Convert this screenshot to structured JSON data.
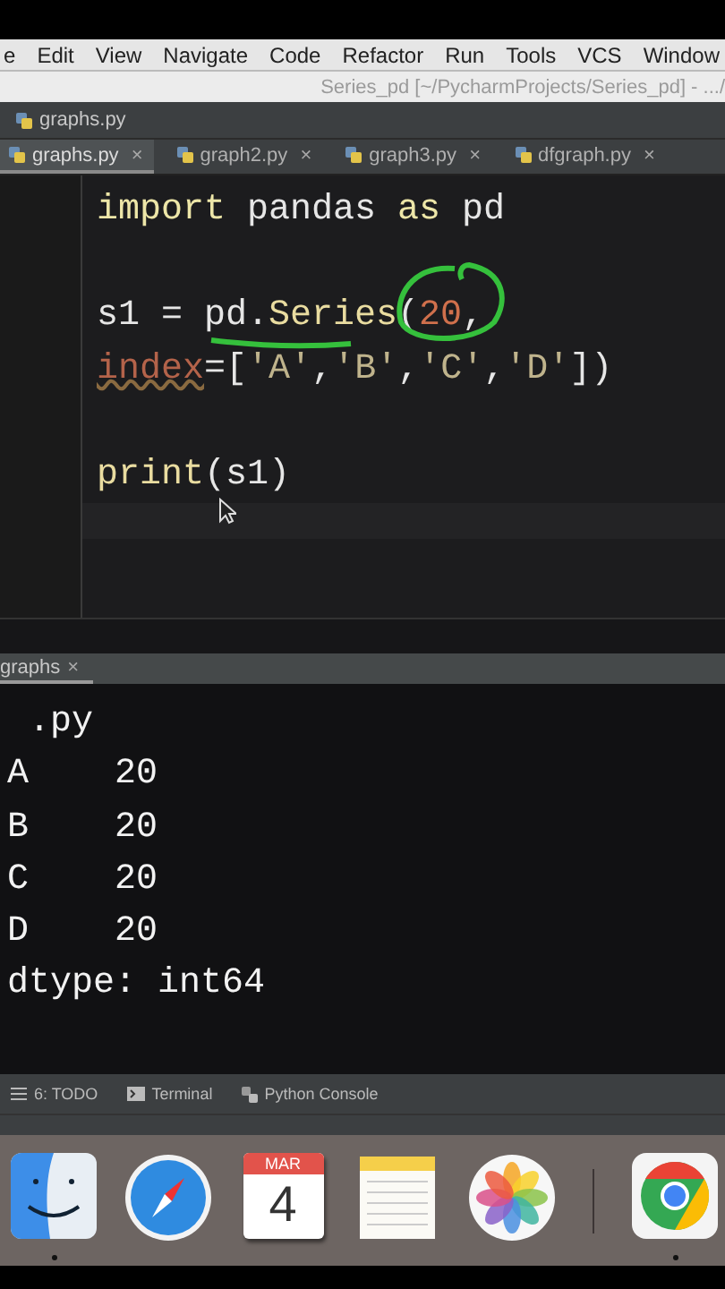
{
  "menu_bar": [
    "e",
    "Edit",
    "View",
    "Navigate",
    "Code",
    "Refactor",
    "Run",
    "Tools",
    "VCS",
    "Window"
  ],
  "title_bar": {
    "title": "Series_pd [~/PycharmProjects/Series_pd] - .../"
  },
  "breadcrumb": {
    "label": "graphs.py"
  },
  "tabs": [
    {
      "label": "graphs.py",
      "selected": true,
      "close": "×"
    },
    {
      "label": "graph2.py",
      "selected": false,
      "close": "×"
    },
    {
      "label": "graph3.py",
      "selected": false,
      "close": "×"
    },
    {
      "label": "dfgraph.py",
      "selected": false,
      "close": "×"
    }
  ],
  "editor": {
    "lines": [
      {
        "kind": "code",
        "tokens": [
          {
            "kind": "keyword",
            "text": "import"
          },
          {
            "kind": "plain",
            "text": " pandas "
          },
          {
            "kind": "keyword",
            "text": "as"
          },
          {
            "kind": "plain",
            "text": " pd"
          }
        ]
      },
      {
        "kind": "blank"
      },
      {
        "kind": "code",
        "tokens": [
          {
            "kind": "plain",
            "text": "s1 = pd."
          },
          {
            "kind": "function",
            "text": "Series"
          },
          {
            "kind": "plain",
            "text": "("
          },
          {
            "kind": "number",
            "text": "20"
          },
          {
            "kind": "plain",
            "text": ","
          }
        ]
      },
      {
        "kind": "code",
        "tokens": [
          {
            "kind": "param",
            "text": "index"
          },
          {
            "kind": "plain",
            "text": "=["
          },
          {
            "kind": "string",
            "text": "'A'"
          },
          {
            "kind": "plain",
            "text": ","
          },
          {
            "kind": "string",
            "text": "'B'"
          },
          {
            "kind": "plain",
            "text": ","
          },
          {
            "kind": "string",
            "text": "'C'"
          },
          {
            "kind": "plain",
            "text": ","
          },
          {
            "kind": "string",
            "text": "'D'"
          },
          {
            "kind": "plain",
            "text": "])"
          }
        ]
      },
      {
        "kind": "blank"
      },
      {
        "kind": "code",
        "tokens": [
          {
            "kind": "function",
            "text": "print"
          },
          {
            "kind": "plain",
            "text": "(s1)"
          }
        ]
      }
    ]
  },
  "run_panel": {
    "tab": {
      "label": "graphs",
      "close": "×"
    },
    "output": [
      " .py",
      "A    20",
      "B    20",
      "C    20",
      "D    20",
      "dtype: int64"
    ]
  },
  "tool_bar": [
    {
      "kind": "todo",
      "label": "6: TODO"
    },
    {
      "kind": "terminal",
      "label": "Terminal"
    },
    {
      "kind": "console",
      "label": "Python Console"
    }
  ],
  "dock": [
    {
      "kind": "finder",
      "running": true
    },
    {
      "kind": "safari",
      "running": false
    },
    {
      "kind": "calendar",
      "running": false,
      "month": "MAR",
      "day": "4"
    },
    {
      "kind": "notes",
      "running": false
    },
    {
      "kind": "photos",
      "running": false
    },
    {
      "kind": "separator"
    },
    {
      "kind": "chrome",
      "running": true
    }
  ]
}
